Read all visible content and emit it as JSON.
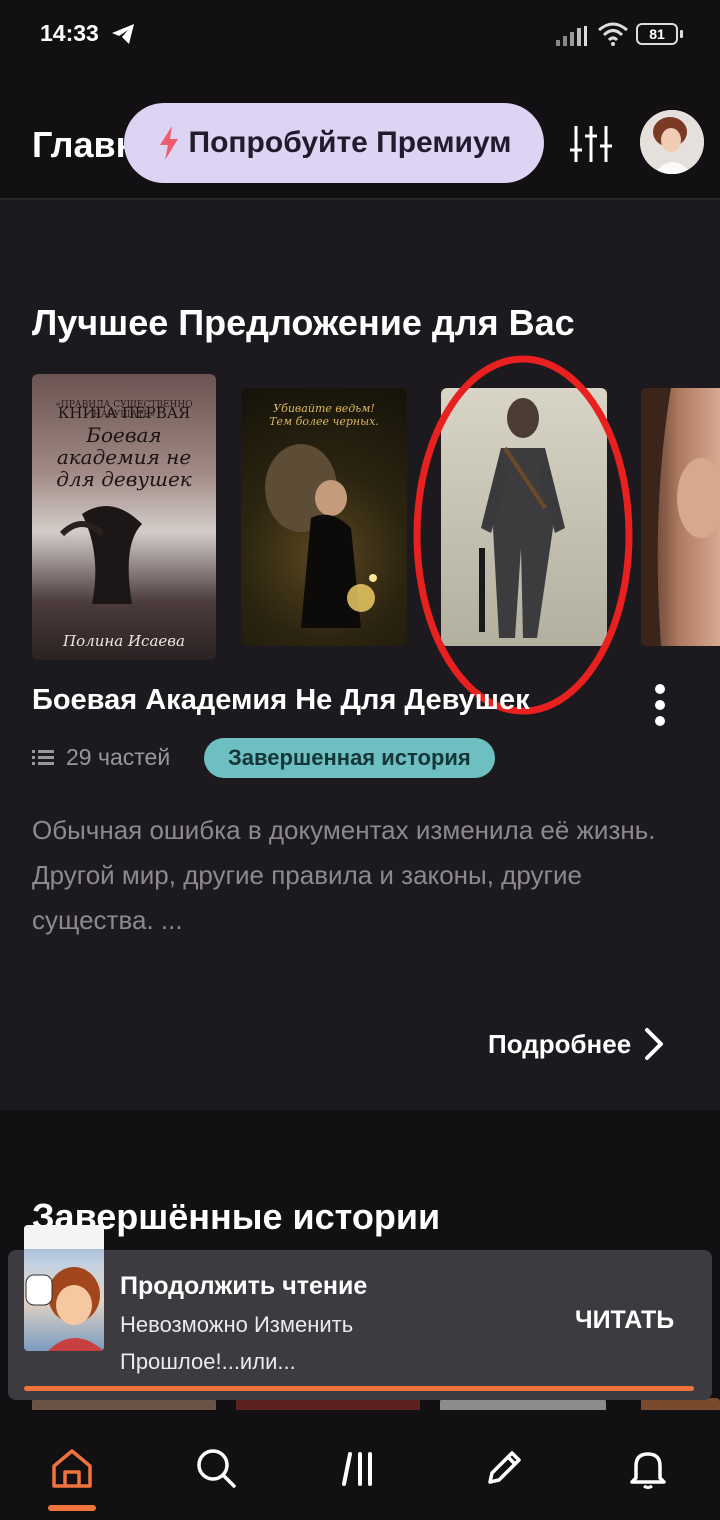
{
  "status_bar": {
    "time": "14:33",
    "battery": "81"
  },
  "header": {
    "title": "Главная",
    "premium_label": "Попробуйте Премиум"
  },
  "featured": {
    "section_title": "Лучшее Предложение для Вас",
    "covers": [
      {
        "top_line": "«ПРАВИЛА СУЩЕСТВЕННО НАРУШАТЬ»",
        "subtitle": "КНИГА ПЕРВАЯ",
        "title": "Боевая академия не для девушек",
        "author": "Полина Исаева"
      },
      {
        "tagline": "Убивайте ведьм! Тем более черных."
      },
      {},
      {}
    ],
    "book_title": "Боевая Академия Не Для Девушек",
    "parts": "29 частей",
    "status_badge": "Завершенная история",
    "description": "Обычная ошибка в документах изменила её жизнь.\nДругой мир, другие правила и законы, другие существа. ...",
    "details_label": "Подробнее"
  },
  "completed": {
    "section_title": "Завершённые истории"
  },
  "continue_reading": {
    "title": "Продолжить чтение",
    "book": "Невозможно Изменить Прошлое!...или...",
    "read_label": "ЧИТАТЬ",
    "progress": 1.0
  },
  "nav": {
    "items": [
      "home-icon",
      "search-icon",
      "library-icon",
      "write-icon",
      "bell-icon"
    ],
    "active": "home",
    "accent": "#f0733d"
  },
  "colors": {
    "premium_bg": "#ddd3f3",
    "badge_bg": "#6ebfc1",
    "annotation": "#e8201f"
  }
}
